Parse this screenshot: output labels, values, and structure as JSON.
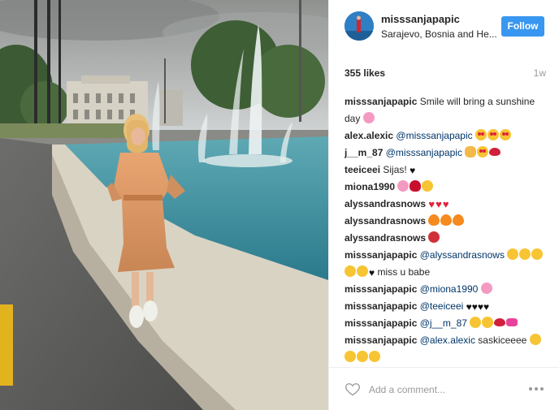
{
  "post": {
    "username": "misssanjapapic",
    "location": "Sarajevo, Bosnia and He...",
    "follow_label": "Follow",
    "likes": "355 likes",
    "age": "1w",
    "comment_placeholder": "Add a comment...",
    "more_label": "•••"
  },
  "comments": [
    {
      "user": "misssanjapapic",
      "parts": [
        {
          "t": "text",
          "v": "Smile will bring a sunshine day "
        },
        {
          "t": "emo",
          "c": "flower"
        }
      ]
    },
    {
      "user": "alex.alexic",
      "parts": [
        {
          "t": "mention",
          "v": "@misssanjapapic"
        },
        {
          "t": "text",
          "v": " "
        },
        {
          "t": "emo",
          "c": "hearteye"
        },
        {
          "t": "emo",
          "c": "hearteye"
        },
        {
          "t": "emo",
          "c": "hearteye"
        }
      ]
    },
    {
      "user": "j__m_87",
      "parts": [
        {
          "t": "mention",
          "v": "@misssanjapapic"
        },
        {
          "t": "text",
          "v": " "
        },
        {
          "t": "emo",
          "c": "ok"
        },
        {
          "t": "emo",
          "c": "hearteye"
        },
        {
          "t": "emo",
          "c": "lips"
        }
      ]
    },
    {
      "user": "teeiceei",
      "parts": [
        {
          "t": "text",
          "v": "Sijas! "
        },
        {
          "t": "bheart"
        }
      ]
    },
    {
      "user": "miona1990",
      "parts": [
        {
          "t": "emo",
          "c": "flower"
        },
        {
          "t": "emo",
          "c": "rose"
        },
        {
          "t": "emo",
          "c": "smile"
        }
      ]
    },
    {
      "user": "alyssandrasnows",
      "parts": [
        {
          "t": "heart"
        },
        {
          "t": "heart"
        },
        {
          "t": "heart"
        }
      ]
    },
    {
      "user": "alyssandrasnows",
      "parts": [
        {
          "t": "emo",
          "c": "fire"
        },
        {
          "t": "emo",
          "c": "fire"
        },
        {
          "t": "emo",
          "c": "fire"
        }
      ]
    },
    {
      "user": "alyssandrasnows",
      "parts": [
        {
          "t": "emo",
          "c": "devil"
        }
      ]
    },
    {
      "user": "misssanjapapic",
      "parts": [
        {
          "t": "mention",
          "v": "@alyssandrasnows"
        },
        {
          "t": "text",
          "v": " "
        },
        {
          "t": "emo",
          "c": "smile"
        },
        {
          "t": "emo",
          "c": "smile"
        },
        {
          "t": "emo",
          "c": "smile"
        },
        {
          "t": "emo",
          "c": "smile"
        },
        {
          "t": "emo",
          "c": "smile"
        },
        {
          "t": "bheart"
        },
        {
          "t": "text",
          "v": " miss u babe"
        }
      ]
    },
    {
      "user": "misssanjapapic",
      "parts": [
        {
          "t": "mention",
          "v": "@miona1990"
        },
        {
          "t": "text",
          "v": " "
        },
        {
          "t": "emo",
          "c": "flower"
        }
      ]
    },
    {
      "user": "misssanjapapic",
      "parts": [
        {
          "t": "mention",
          "v": "@teeiceei"
        },
        {
          "t": "text",
          "v": " "
        },
        {
          "t": "bheart"
        },
        {
          "t": "bheart"
        },
        {
          "t": "bheart"
        },
        {
          "t": "bheart"
        }
      ]
    },
    {
      "user": "misssanjapapic",
      "parts": [
        {
          "t": "mention",
          "v": "@j__m_87"
        },
        {
          "t": "text",
          "v": " "
        },
        {
          "t": "emo",
          "c": "smile"
        },
        {
          "t": "emo",
          "c": "smile"
        },
        {
          "t": "emo",
          "c": "lips"
        },
        {
          "t": "emo",
          "c": "bow"
        }
      ]
    },
    {
      "user": "misssanjapapic",
      "parts": [
        {
          "t": "mention",
          "v": "@alex.alexic"
        },
        {
          "t": "text",
          "v": " saskiceeee "
        },
        {
          "t": "emo",
          "c": "smile"
        },
        {
          "t": "emo",
          "c": "smile"
        },
        {
          "t": "emo",
          "c": "smile"
        },
        {
          "t": "emo",
          "c": "smile"
        }
      ]
    }
  ],
  "icons": {
    "avatar": "avatar-photo",
    "like": "heart-outline-icon",
    "more": "more-options-icon"
  },
  "colors": {
    "follow_button": "#3897f0",
    "mention": "#003569",
    "text": "#262626",
    "muted": "#999999"
  }
}
